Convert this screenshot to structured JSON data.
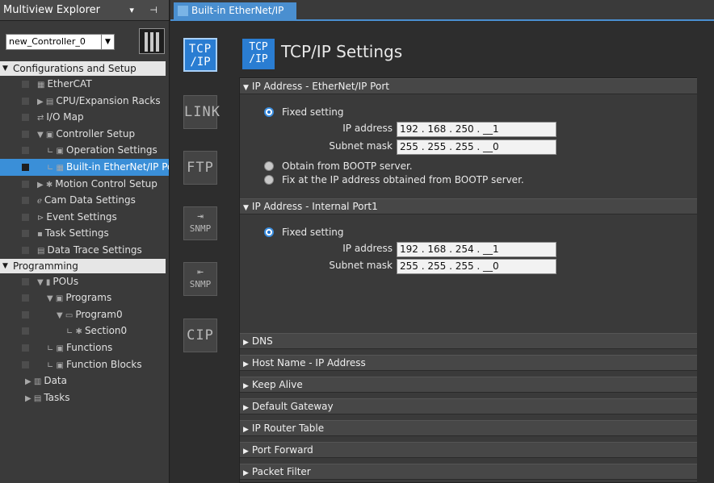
{
  "explorer": {
    "title": "Multiview Explorer",
    "pin_tools": "▾ ⊣",
    "controller": "new_Controller_0",
    "config_section": "Configurations and Setup",
    "config_items": [
      {
        "label": "EtherCAT",
        "icon": "▦",
        "indent": 0
      },
      {
        "label": "CPU/Expansion Racks",
        "icon": "▶ ▤",
        "indent": 0
      },
      {
        "label": "I/O Map",
        "icon": "⇄",
        "indent": 0
      },
      {
        "label": "Controller Setup",
        "icon": "▼ ▣",
        "indent": 0
      },
      {
        "label": "Operation Settings",
        "icon": "∟ ▣",
        "indent": 1
      },
      {
        "label": "Built-in EtherNet/IP Port Settings",
        "icon": "∟ ▦",
        "indent": 1
      },
      {
        "label": "Motion Control Setup",
        "icon": "▶ ✱",
        "indent": 0
      },
      {
        "label": "Cam Data Settings",
        "icon": "ℯ",
        "indent": 0
      },
      {
        "label": "Event Settings",
        "icon": "⊳",
        "indent": 0
      },
      {
        "label": "Task Settings",
        "icon": "▪",
        "indent": 0
      },
      {
        "label": "Data Trace Settings",
        "icon": "▤",
        "indent": 0
      }
    ],
    "programming_section": "Programming",
    "programming_items": [
      {
        "label": "POUs",
        "icon": "▼ ▮",
        "indent": 0
      },
      {
        "label": "Programs",
        "icon": "▼ ▣",
        "indent": 1
      },
      {
        "label": "Program0",
        "icon": "▼ ▭",
        "indent": 2
      },
      {
        "label": "Section0",
        "icon": "∟ ✱",
        "indent": 3
      },
      {
        "label": "Functions",
        "icon": "∟ ▣",
        "indent": 1
      },
      {
        "label": "Function Blocks",
        "icon": "∟ ▣",
        "indent": 1
      },
      {
        "label": "Data",
        "icon": "▶ ▥",
        "indent": -1
      },
      {
        "label": "Tasks",
        "icon": "▶ ▤",
        "indent": -1
      }
    ]
  },
  "tab": {
    "label": "Built-in EtherNet/IP Port···",
    "close": "×"
  },
  "nav": {
    "tcpip": [
      "TCP",
      "/IP"
    ],
    "link": "LINK",
    "ftp": "FTP",
    "snmp": "SNMP",
    "snmp_trap": "SNMP",
    "cip": "CIP"
  },
  "page": {
    "title": "TCP/IP Settings",
    "icon_top": "TCP",
    "icon_bottom": "/IP"
  },
  "ethernet_ip": {
    "header": "IP Address - EtherNet/IP Port",
    "fixed": "Fixed setting",
    "ip_label": "IP address",
    "ip_value": "192 . 168 . 250 . __1",
    "mask_label": "Subnet mask",
    "mask_value": "255 . 255 . 255 . __0",
    "bootp": "Obtain from BOOTP server.",
    "bootp_fix": "Fix at the IP address obtained from BOOTP server."
  },
  "internal_port": {
    "header": "IP Address - Internal Port1",
    "fixed": "Fixed setting",
    "ip_label": "IP address",
    "ip_value": "192 . 168 . 254 . __1",
    "mask_label": "Subnet mask",
    "mask_value": "255 . 255 . 255 . __0"
  },
  "collapsed_sections": [
    "DNS",
    "Host Name - IP Address",
    "Keep Alive",
    "Default Gateway",
    "IP Router Table",
    "Port Forward",
    "Packet Filter"
  ],
  "colors": {
    "accent": "#2a7dd2",
    "selection": "#3a8fd8"
  }
}
